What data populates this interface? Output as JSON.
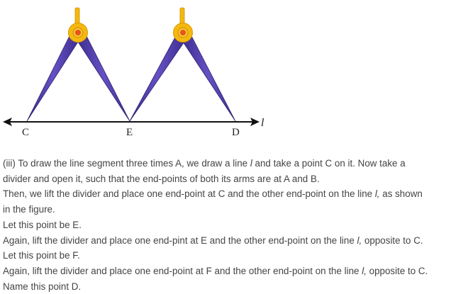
{
  "figure": {
    "points": {
      "c": "C",
      "e": "E",
      "d": "D"
    },
    "line_name": "l",
    "colors": {
      "arm": "#5b45b0",
      "arm_edge": "#2e2270",
      "hinge": "#f5b80f",
      "hinge_center": "#e8521e",
      "line": "#111111"
    }
  },
  "text": {
    "line1": "(iii) To draw the line segment three times A, we draw a line ",
    "line1_l": "l",
    "line1_end": " and take a point C on it. Now take a",
    "line2": "divider and open it, such that the end-points of both its arms are at A and B.",
    "line3": "Then, we lift the divider and place one end-point at C and the other end-point on the line ",
    "line3_l": "l,",
    "line3_end": " as shown",
    "line4": "in the figure.",
    "line5": "Let this point be E.",
    "line6": "Again, lift the divider and place one end-pint at E and the other end-point on the line ",
    "line6_l": "l,",
    "line6_end": " opposite to C.",
    "line7": "Let this point be F.",
    "line8": "Again, lift the divider and place one end-point at F and the other end-point on the line ",
    "line8_l": "l,",
    "line8_end": " opposite to C.",
    "line9": "Name this point D."
  }
}
